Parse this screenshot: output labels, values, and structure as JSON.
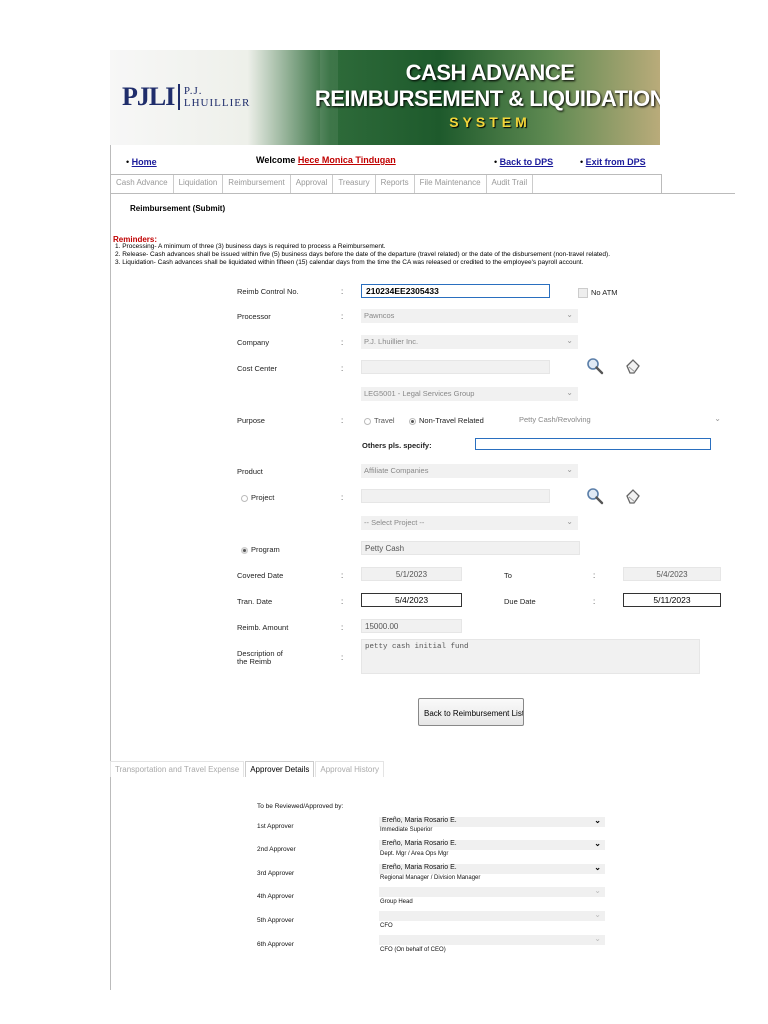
{
  "banner": {
    "logo_initials": "PJLI",
    "logo_name": "P.J. LHUILLIER",
    "title_line1": "CASH ADVANCE",
    "title_line2": "REIMBURSEMENT & LIQUIDATION",
    "title_line3": "SYSTEM"
  },
  "topnav": {
    "home": "Home",
    "welcome_label": "Welcome",
    "user_name": "Hece Monica Tindugan",
    "back": "Back to DPS",
    "exit": "Exit from DPS"
  },
  "tabs": [
    "Cash Advance",
    "Liquidation",
    "Reimbursement",
    "Approval",
    "Treasury",
    "Reports",
    "File Maintenance",
    "Audit Trail"
  ],
  "page_title": "Reimbursement (Submit)",
  "reminders": {
    "title": "Reminders:",
    "items": [
      "1. Processing- A minimum of three (3) business days is required to process a Reimbursement.",
      "2. Release- Cash advances shall be issued within five (5) business days before the date of the departure (travel related) or the date of the disbursement (non-travel related).",
      "3. Liquidation- Cash advances shall be liquidated within fifteen (15) calendar days from the time the CA was released or credited to the employee's payroll account."
    ]
  },
  "form": {
    "colon": ":",
    "control_no_label": "Reimb Control No.",
    "control_no_value": "210234EE2305433",
    "no_atm_label": "No ATM",
    "processor_label": "Processor",
    "processor_value": "Pawncos",
    "company_label": "Company",
    "company_value": "P.J. Lhuillier Inc.",
    "cost_center_label": "Cost Center",
    "cost_center_value": "",
    "cost_center_select": "LEG5001 - Legal Services Group",
    "purpose_label": "Purpose",
    "purpose_travel": "Travel",
    "purpose_nontravel": "Non-Travel Related",
    "purpose_select": "Petty Cash/Revolving",
    "others_label": "Others pls. specify:",
    "others_value": "",
    "product_label": "Product",
    "product_value": "Affiliate Companies",
    "project_label": "Project",
    "project_value": "",
    "project_select": "-- Select Project --",
    "program_label": "Program",
    "program_value": "Petty Cash",
    "covered_label": "Covered Date",
    "covered_from": "5/1/2023",
    "to_label": "To",
    "covered_to": "5/4/2023",
    "tran_label": "Tran. Date",
    "tran_value": "5/4/2023",
    "due_label": "Due Date",
    "due_value": "5/11/2023",
    "amount_label": "Reimb. Amount",
    "amount_value": "15000.00",
    "desc_label_1": "Description of",
    "desc_label_2": "the Reimb",
    "desc_value": "petty cash initial fund",
    "back_button": "Back to Reimbursement List"
  },
  "bottom_tabs": [
    "Transportation and Travel Expense",
    "Approver Details",
    "Approval History"
  ],
  "approvers": {
    "heading": "To be Reviewed/Approved by:",
    "rows": [
      {
        "label": "1st Approver",
        "name": "Ereño, Maria Rosario E.",
        "role": "Immediate Superior"
      },
      {
        "label": "2nd Approver",
        "name": "Ereño, Maria Rosario E.",
        "role": "Dept. Mgr / Area Ops Mgr"
      },
      {
        "label": "3rd Approver",
        "name": "Ereño, Maria Rosario E.",
        "role": "Regional Manager / Division Manager"
      },
      {
        "label": "4th Approver",
        "name": "",
        "role": "Group Head"
      },
      {
        "label": "5th Approver",
        "name": "",
        "role": "CFO"
      },
      {
        "label": "6th Approver",
        "name": "",
        "role": "CFO (On behalf of CEO)"
      }
    ]
  },
  "colors": {
    "accent_green": "#1e5a2c",
    "link_blue": "#1a1a9a",
    "alert_red": "#c00000"
  }
}
